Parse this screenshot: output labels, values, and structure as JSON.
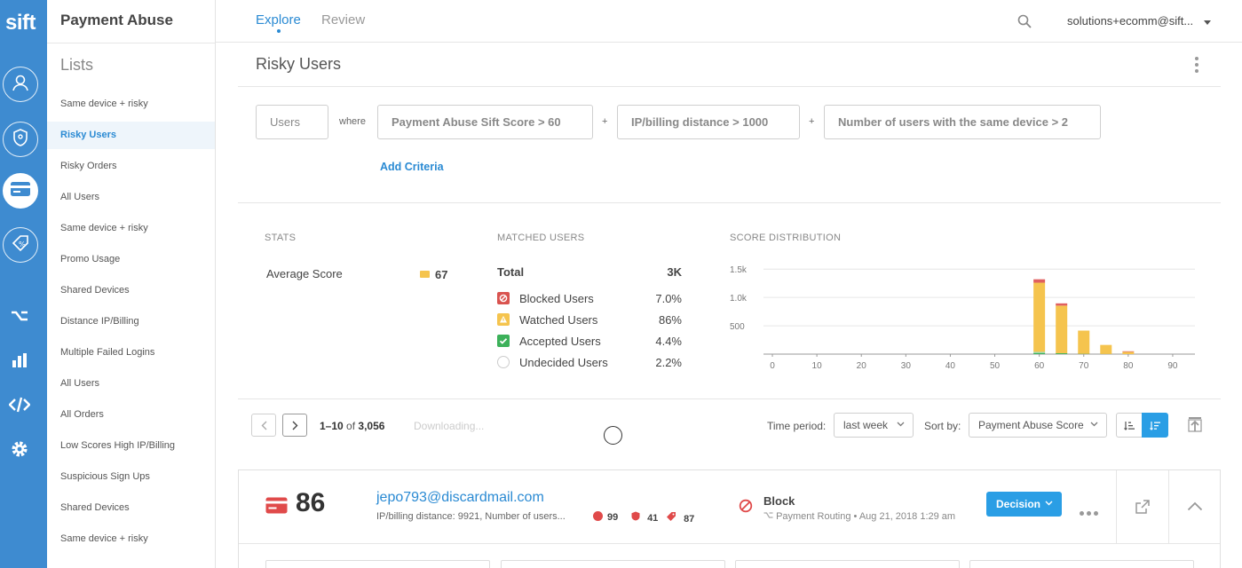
{
  "app": {
    "logo": "sift",
    "product": "Payment Abuse"
  },
  "rail": {
    "icons": [
      "user-icon",
      "shield-icon",
      "credit-card-icon",
      "promo-tag-icon",
      "workflow-icon",
      "bar-chart-icon",
      "code-icon",
      "gear-icon"
    ],
    "active": "credit-card-icon"
  },
  "nav": {
    "tabs": [
      {
        "label": "Explore",
        "active": true
      },
      {
        "label": "Review",
        "active": false
      }
    ],
    "user": "solutions+ecomm@sift..."
  },
  "lists": {
    "title": "Lists",
    "items": [
      "Same device + risky",
      "Risky Users",
      "Risky Orders",
      "All Users",
      "Same device + risky",
      "Promo Usage",
      "Shared Devices",
      "Distance IP/Billing",
      "Multiple Failed Logins",
      "All Users",
      "All Orders",
      "Low Scores High IP/Billing",
      "Suspicious Sign Ups",
      "Shared Devices",
      "Same device + risky"
    ],
    "active_index": 1
  },
  "page": {
    "title": "Risky Users"
  },
  "query": {
    "entity": "Users",
    "where": "where",
    "criteria": [
      "Payment Abuse Sift Score > 60",
      "IP/billing distance > 1000",
      "Number of users with the same device > 2"
    ],
    "joiner": "+",
    "add_label": "Add Criteria"
  },
  "stats": {
    "label": "STATS",
    "average_label": "Average Score",
    "average_value": "67"
  },
  "matched": {
    "label": "MATCHED USERS",
    "total_label": "Total",
    "total_value": "3K",
    "rows": [
      {
        "label": "Blocked Users",
        "value": "7.0%",
        "color": "#d9534f",
        "icon": "blocked-icon"
      },
      {
        "label": "Watched Users",
        "value": "86%",
        "color": "#f5c44e",
        "icon": "watch-icon"
      },
      {
        "label": "Accepted Users",
        "value": "4.4%",
        "color": "#3cb15a",
        "icon": "check-icon"
      },
      {
        "label": "Undecided Users",
        "value": "2.2%",
        "color": "#cccccc",
        "icon": "undecided-icon"
      }
    ]
  },
  "chart_data": {
    "type": "bar",
    "title": "SCORE DISTRIBUTION",
    "stacked": true,
    "x": [
      60,
      65,
      70,
      75,
      80
    ],
    "xticks": [
      0,
      10,
      20,
      30,
      40,
      50,
      60,
      70,
      80,
      90
    ],
    "ytick_labels": [
      "1.5k",
      "1.0k",
      "500"
    ],
    "yticks": [
      1500,
      1000,
      500
    ],
    "ylim": [
      0,
      1550
    ],
    "xlim": [
      -2,
      95
    ],
    "grid": true,
    "series": [
      {
        "name": "Accepted Users",
        "color": "#3cb15a",
        "values": [
          20,
          15,
          5,
          2,
          0
        ]
      },
      {
        "name": "Undecided Users",
        "color": "#9fd9b0",
        "values": [
          20,
          0,
          0,
          0,
          0
        ]
      },
      {
        "name": "Watched Users",
        "color": "#f5c44e",
        "values": [
          1220,
          840,
          410,
          160,
          40
        ]
      },
      {
        "name": "Blocked Users",
        "color": "#e06060",
        "values": [
          60,
          40,
          0,
          0,
          10
        ]
      }
    ]
  },
  "toolbar": {
    "range": "1–10",
    "of": "of",
    "count": "3,056",
    "downloading": "Downloading...",
    "time_label": "Time period:",
    "time_value": "last week",
    "sort_label": "Sort by:",
    "sort_value": "Payment Abuse Score"
  },
  "user_card": {
    "score": "86",
    "email": "jepo793@discardmail.com",
    "meta": "IP/billing distance: 9921, Number of users...",
    "badges": [
      {
        "icon": "user-badge-icon",
        "value": "99"
      },
      {
        "icon": "shield-badge-icon",
        "value": "41"
      },
      {
        "icon": "tag-badge-icon",
        "value": "87"
      }
    ],
    "decision_title": "Block",
    "decision_source": "Payment Routing",
    "decision_time": "Aug 21, 2018 1:29 am",
    "decision_button": "Decision"
  }
}
